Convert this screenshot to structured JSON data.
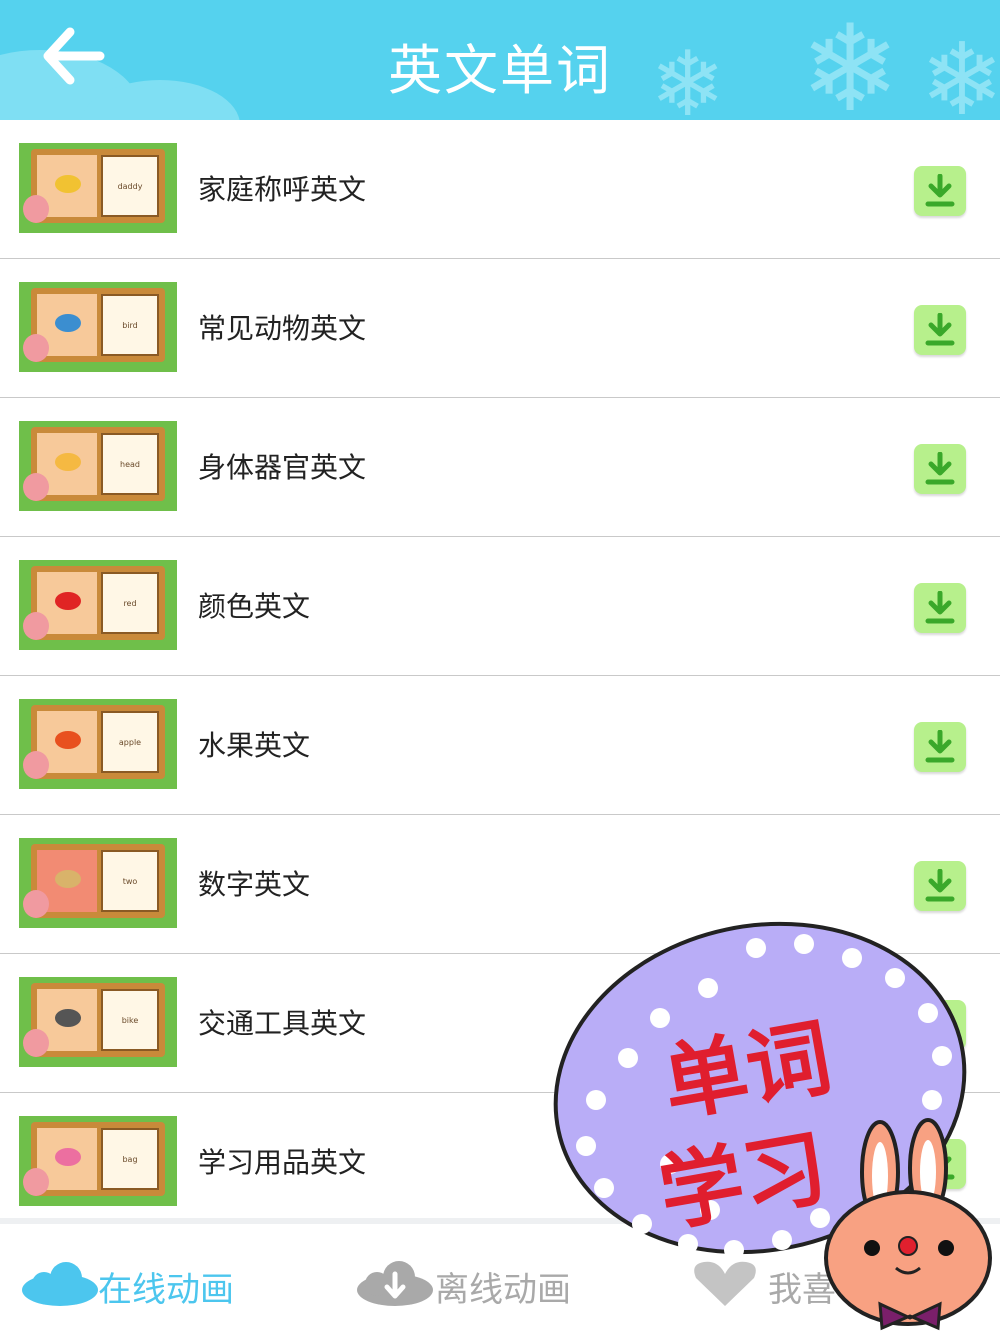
{
  "header": {
    "title": "英文单词",
    "back_icon": "arrow-left-icon"
  },
  "items": [
    {
      "label": "家庭称呼英文",
      "card": "daddy",
      "object_color": "#f1c232"
    },
    {
      "label": "常见动物英文",
      "card": "bird",
      "object_color": "#3b8ed0"
    },
    {
      "label": "身体器官英文",
      "card": "head",
      "object_color": "#f5b942"
    },
    {
      "label": "颜色英文",
      "card": "red",
      "object_color": "#e02424"
    },
    {
      "label": "水果英文",
      "card": "apple",
      "object_color": "#e8501e"
    },
    {
      "label": "数字英文",
      "card": "two",
      "object_color": "#d9b36a"
    },
    {
      "label": "交通工具英文",
      "card": "bike",
      "object_color": "#555555"
    },
    {
      "label": "学习用品英文",
      "card": "bag",
      "object_color": "#ec6fa0"
    }
  ],
  "tabs": [
    {
      "label": "在线动画",
      "icon": "cloud-icon",
      "active": true,
      "color": "#4cc6ee"
    },
    {
      "label": "离线动画",
      "icon": "cloud-download-icon",
      "active": false,
      "color": "#a9a9a9"
    },
    {
      "label": "我喜",
      "icon": "heart-icon",
      "active": false,
      "color": "#a9a9a9"
    }
  ],
  "sticker": {
    "line1": "单词",
    "line2": "学习"
  },
  "colors": {
    "header": "#55d2ee",
    "download": "#b7f08c",
    "sticker": "#b9adf7",
    "sticker_text": "#e01e2e"
  }
}
